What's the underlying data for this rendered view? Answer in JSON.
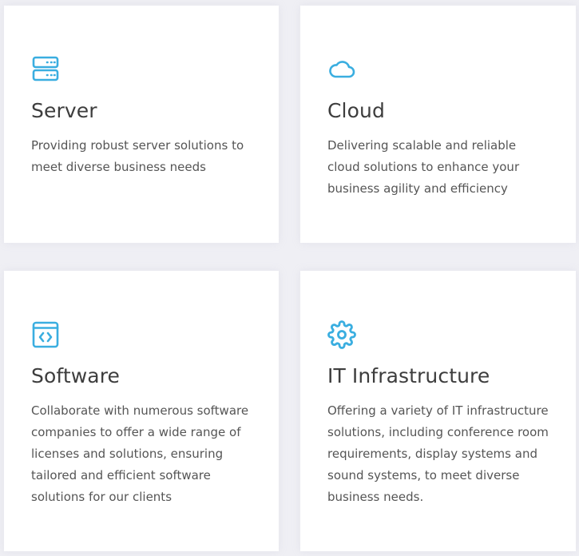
{
  "colors": {
    "background": "#efeff4",
    "card": "#ffffff",
    "accent": "#3aaee0",
    "title": "#3d3d3d",
    "text": "#555555"
  },
  "cards": [
    {
      "icon": "server-icon",
      "title": "Server",
      "description": "Providing robust server solutions to meet diverse business needs"
    },
    {
      "icon": "cloud-icon",
      "title": "Cloud",
      "description": "Delivering scalable and reliable cloud solutions to enhance your business agility and efficiency"
    },
    {
      "icon": "code-window-icon",
      "title": "Software",
      "description": "Collaborate with numerous software companies to offer a wide range of licenses and solutions, ensuring tailored and efficient software solutions for our clients"
    },
    {
      "icon": "gear-icon",
      "title": "IT Infrastructure",
      "description": "Offering a variety of IT infrastructure solutions, including conference room requirements, display systems and sound systems, to meet diverse business needs."
    }
  ]
}
